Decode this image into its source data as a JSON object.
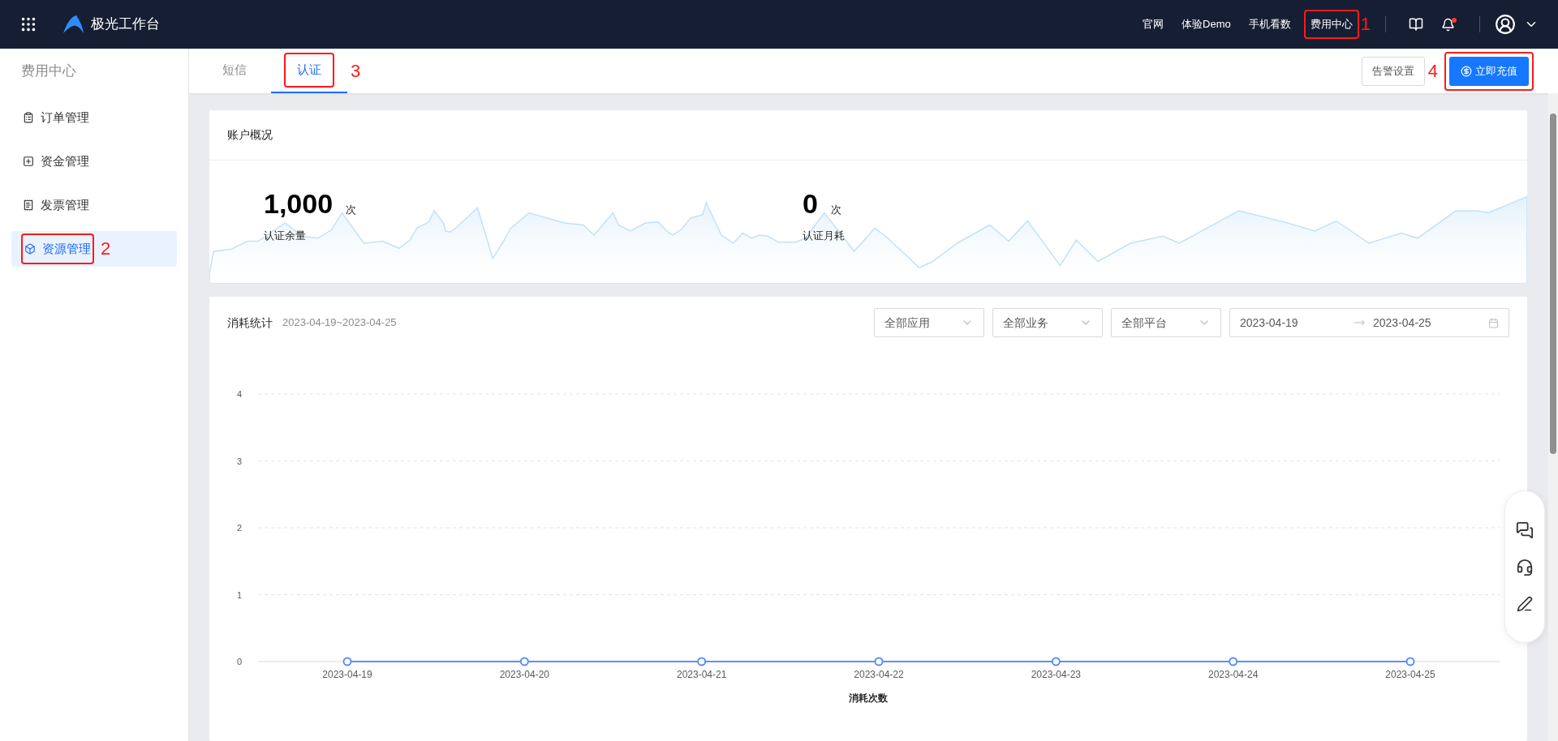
{
  "header": {
    "brand": "极光工作台",
    "nav": [
      {
        "label": "官网"
      },
      {
        "label": "体验Demo"
      },
      {
        "label": "手机看数"
      },
      {
        "label": "费用中心",
        "callout": "1"
      }
    ],
    "notification_dot": true
  },
  "sidebar": {
    "title": "费用中心",
    "items": [
      {
        "label": "订单管理",
        "selected": false
      },
      {
        "label": "资金管理",
        "selected": false
      },
      {
        "label": "发票管理",
        "selected": false
      },
      {
        "label": "资源管理",
        "selected": true,
        "callout": "2"
      }
    ]
  },
  "tabs": [
    {
      "label": "短信",
      "selected": false
    },
    {
      "label": "认证",
      "selected": true,
      "callout": "3"
    }
  ],
  "actions": {
    "alert_settings": "告警设置",
    "recharge": {
      "label": "立即充值",
      "callout": "4"
    }
  },
  "overview": {
    "title": "账户概况",
    "stats": [
      {
        "value": "1,000",
        "unit": "次",
        "label": "认证余量"
      },
      {
        "value": "0",
        "unit": "次",
        "label": "认证月耗"
      }
    ]
  },
  "consumption": {
    "title": "消耗统计",
    "range": "2023-04-19~2023-04-25",
    "filters": [
      "全部应用",
      "全部业务",
      "全部平台"
    ],
    "date_start": "2023-04-19",
    "date_end": "2023-04-25",
    "chart_data": {
      "type": "line",
      "xlabel": "消耗次数",
      "categories": [
        "2023-04-19",
        "2023-04-20",
        "2023-04-21",
        "2023-04-22",
        "2023-04-23",
        "2023-04-24",
        "2023-04-25"
      ],
      "grid": true,
      "series": [
        {
          "color": "#5b8ff9",
          "marker": true,
          "values": [
            0,
            0,
            0,
            0,
            0,
            0,
            0
          ]
        }
      ],
      "ylim": [
        0,
        4
      ],
      "yticks": [
        0,
        1,
        2,
        3,
        4
      ]
    }
  }
}
